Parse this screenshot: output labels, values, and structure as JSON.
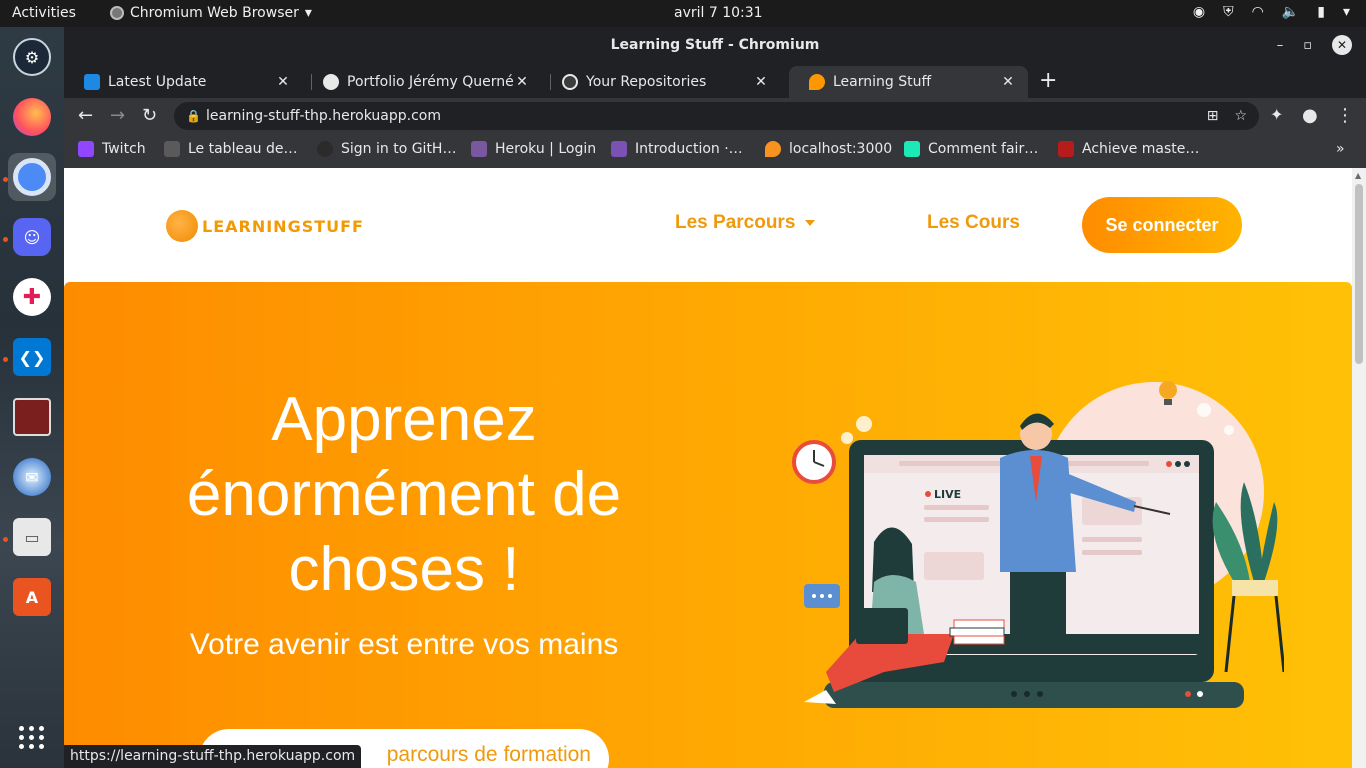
{
  "system": {
    "activities": "Activities",
    "app_name": "Chromium Web Browser",
    "clock": "avril 7  10:31"
  },
  "window": {
    "title": "Learning Stuff - Chromium"
  },
  "tabs": [
    {
      "label": "Latest Update",
      "favicon_color": "#1e88e5"
    },
    {
      "label": "Portfolio Jérémy Querné",
      "favicon_color": "#e8e8e8"
    },
    {
      "label": "Your Repositories",
      "favicon_color": "#e8e8e8"
    },
    {
      "label": "Learning Stuff",
      "favicon_color": "#ff9800"
    }
  ],
  "address": {
    "url": "learning-stuff-thp.herokuapp.com"
  },
  "bookmarks": [
    {
      "label": "Twitch",
      "color": "#9146ff"
    },
    {
      "label": "Le tableau de…",
      "color": "#5a5a5a"
    },
    {
      "label": "Sign in to GitH…",
      "color": "#2b2b2b"
    },
    {
      "label": "Heroku | Login",
      "color": "#79589f"
    },
    {
      "label": "Introduction ·…",
      "color": "#7952b3"
    },
    {
      "label": "localhost:3000",
      "color": "#f7931e"
    },
    {
      "label": "Comment fair…",
      "color": "#1de9b6"
    },
    {
      "label": "Achieve maste…",
      "color": "#b71c1c"
    }
  ],
  "site": {
    "logo_text": "LEARNINGSTUFF",
    "nav_parcours": "Les Parcours",
    "nav_cours": "Les Cours",
    "login": "Se connecter",
    "hero_title": "Apprenez énormément de choses !",
    "hero_subtitle": "Votre avenir est entre vos mains",
    "hero_cta": "parcours de formation",
    "illustration_badge": "LIVE"
  },
  "status_bar": "https://learning-stuff-thp.herokuapp.com",
  "colors": {
    "brand_orange": "#ef9a0e",
    "hero_start": "#fe8c00",
    "hero_end": "#ffc107"
  }
}
